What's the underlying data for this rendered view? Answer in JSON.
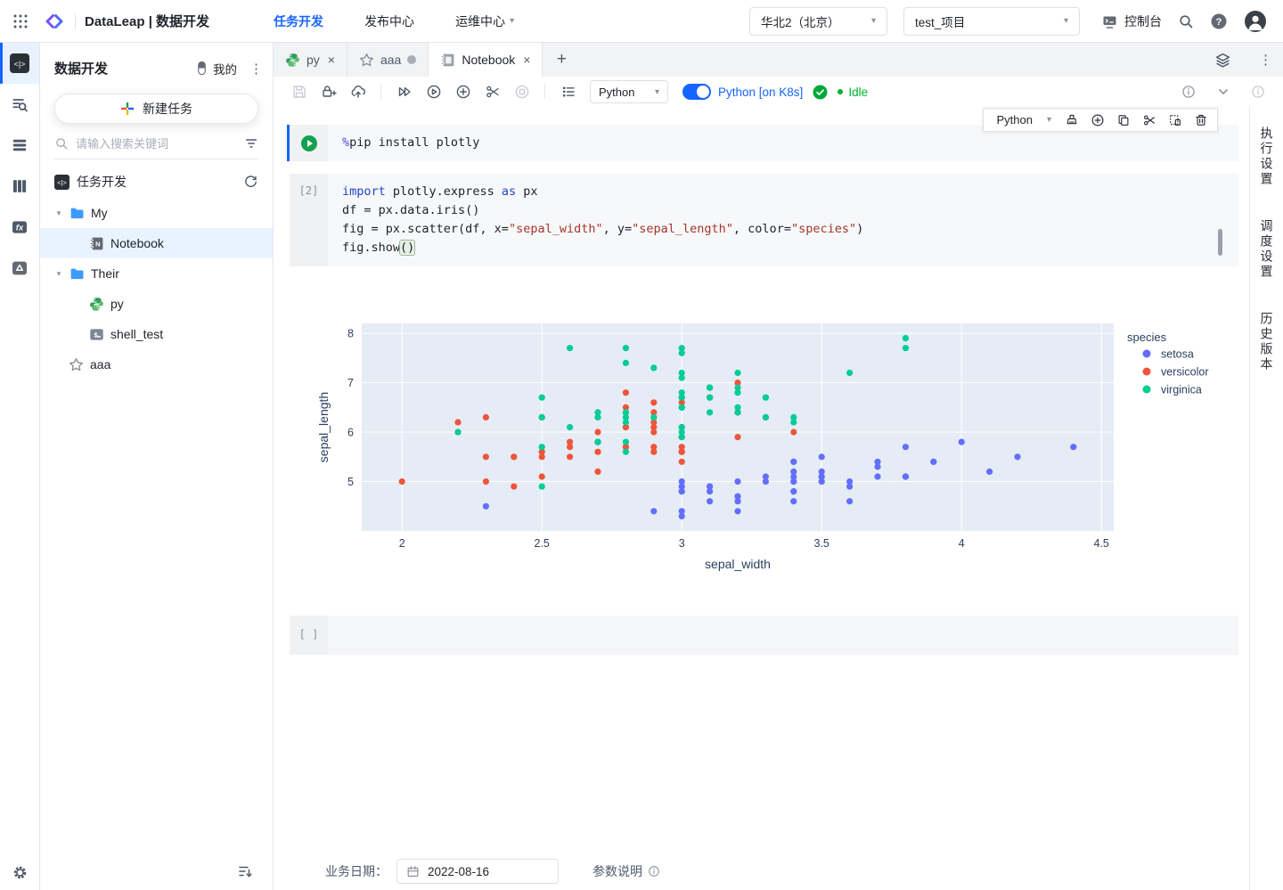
{
  "glyphs": {
    "close": "×",
    "plus": "+",
    "kebab": "⋮",
    "caret": "▾",
    "chev_expanded": "▾"
  },
  "navbar": {
    "brand": "DataLeap | 数据开发",
    "nav": [
      {
        "label": "任务开发",
        "active": true
      },
      {
        "label": "发布中心",
        "active": false
      },
      {
        "label": "运维中心",
        "active": false,
        "dropdown": true
      }
    ],
    "region_select": "华北2（北京）",
    "project_select": "test_项目",
    "console_label": "控制台"
  },
  "rail": {
    "items": [
      {
        "icon": "code",
        "active": true
      },
      {
        "icon": "search-list",
        "active": false
      },
      {
        "icon": "task-list",
        "active": false
      },
      {
        "icon": "data-columns",
        "active": false
      },
      {
        "icon": "function",
        "active": false
      },
      {
        "icon": "resource-drive",
        "active": false
      }
    ]
  },
  "sidebar": {
    "title": "数据开发",
    "mine_label": "我的",
    "new_task_label": "新建任务",
    "search_placeholder": "请输入搜索关键词",
    "section_title": "任务开发",
    "tree": [
      {
        "kind": "folder",
        "label": "My",
        "indent": "a",
        "chevron": true,
        "selected": false
      },
      {
        "kind": "notebook",
        "label": "Notebook",
        "indent": "b",
        "chevron": false,
        "selected": true
      },
      {
        "kind": "folder",
        "label": "Their",
        "indent": "a",
        "chevron": true,
        "selected": false
      },
      {
        "kind": "python",
        "label": "py",
        "indent": "b",
        "chevron": false,
        "selected": false
      },
      {
        "kind": "shell",
        "label": "shell_test",
        "indent": "b",
        "chevron": false,
        "selected": false
      },
      {
        "kind": "star",
        "label": "aaa",
        "indent": "c",
        "chevron": false,
        "selected": false
      }
    ]
  },
  "workspace": {
    "tabs": [
      {
        "label": "py",
        "icon": "python",
        "closable": true,
        "dot": false,
        "active": false
      },
      {
        "label": "aaa",
        "icon": "star",
        "closable": false,
        "dot": true,
        "active": false
      },
      {
        "label": "Notebook",
        "icon": "notebook",
        "closable": true,
        "dot": false,
        "active": true
      }
    ],
    "toolbar": {
      "kernel_select": "Python",
      "k8s_label": "Python [on K8s]",
      "status": "Idle"
    },
    "cell_toolbar": {
      "lang_select": "Python"
    },
    "cells": [
      {
        "index": "",
        "runnable": true,
        "lines": [
          [
            {
              "t": "%",
              "c": "magic"
            },
            {
              "t": "pip install plotly",
              "c": ""
            }
          ]
        ]
      },
      {
        "index": "[2]",
        "runnable": false,
        "lines": [
          [
            {
              "t": "import",
              "c": "kw"
            },
            {
              "t": " plotly.express ",
              "c": ""
            },
            {
              "t": "as",
              "c": "kw"
            },
            {
              "t": " px",
              "c": ""
            }
          ],
          [
            {
              "t": "df = px.data.iris()",
              "c": ""
            }
          ],
          [
            {
              "t": "fig = px.scatter(df, x=",
              "c": ""
            },
            {
              "t": "\"sepal_width\"",
              "c": "str"
            },
            {
              "t": ", y=",
              "c": ""
            },
            {
              "t": "\"sepal_length\"",
              "c": "str"
            },
            {
              "t": ", color=",
              "c": ""
            },
            {
              "t": "\"species\"",
              "c": "str"
            },
            {
              "t": ")",
              "c": ""
            }
          ],
          [
            {
              "t": "fig.show",
              "c": ""
            },
            {
              "t": "()",
              "c": "br"
            }
          ]
        ]
      }
    ],
    "empty_cell_gutter": "[ ]",
    "bottom_bar": {
      "date_label": "业务日期：",
      "date_value": "2022-08-16",
      "params_label": "参数说明"
    }
  },
  "right_panel": {
    "tabs": [
      "执行设置",
      "调度设置",
      "历史版本"
    ]
  },
  "chart_data": {
    "type": "scatter",
    "xlabel": "sepal_width",
    "ylabel": "sepal_length",
    "legend_title": "species",
    "xlim": [
      1.856,
      4.544
    ],
    "ylim": [
      4.0,
      8.2
    ],
    "xticks": [
      2,
      2.5,
      3,
      3.5,
      4,
      4.5
    ],
    "yticks": [
      5,
      6,
      7,
      8
    ],
    "grid": true,
    "legend_position": "right",
    "plot_bg": "#E5ECF6",
    "grid_color": "#FFFFFF",
    "text_color": "#2A3F5F",
    "series": [
      {
        "name": "setosa",
        "color": "#636EFA",
        "x": [
          3.5,
          3.0,
          3.2,
          3.1,
          3.6,
          3.9,
          3.4,
          3.4,
          2.9,
          3.1,
          3.7,
          3.4,
          3.0,
          3.0,
          4.0,
          4.4,
          3.9,
          3.5,
          3.8,
          3.8,
          3.4,
          3.7,
          3.6,
          3.3,
          3.4,
          3.0,
          3.4,
          3.5,
          3.4,
          3.2,
          3.1,
          3.4,
          4.1,
          4.2,
          3.1,
          3.2,
          3.5,
          3.6,
          3.0,
          3.4,
          3.5,
          2.3,
          3.2,
          3.5,
          3.8,
          3.0,
          3.8,
          3.2,
          3.7,
          3.3
        ],
        "y": [
          5.1,
          4.9,
          4.7,
          4.6,
          5.0,
          5.4,
          4.6,
          5.0,
          4.4,
          4.9,
          5.4,
          4.8,
          4.8,
          4.3,
          5.8,
          5.7,
          5.4,
          5.1,
          5.7,
          5.1,
          5.4,
          5.1,
          4.6,
          5.1,
          4.8,
          5.0,
          5.0,
          5.2,
          5.2,
          4.7,
          4.8,
          5.4,
          5.2,
          5.5,
          4.9,
          5.0,
          5.5,
          4.9,
          4.4,
          5.1,
          5.0,
          4.5,
          4.4,
          5.0,
          5.1,
          4.8,
          5.1,
          4.6,
          5.3,
          5.0
        ]
      },
      {
        "name": "versicolor",
        "color": "#EF553B",
        "x": [
          3.2,
          3.2,
          3.1,
          2.3,
          2.8,
          2.8,
          3.3,
          2.4,
          2.9,
          2.7,
          2.0,
          3.0,
          2.2,
          2.9,
          2.9,
          3.1,
          3.0,
          2.7,
          2.2,
          2.5,
          3.2,
          2.8,
          2.5,
          2.8,
          2.9,
          3.0,
          2.8,
          3.0,
          2.9,
          2.6,
          2.4,
          2.4,
          2.7,
          2.7,
          3.0,
          3.4,
          3.1,
          2.3,
          3.0,
          2.5,
          2.6,
          3.0,
          2.6,
          2.3,
          2.7,
          3.0,
          2.9,
          2.9,
          2.5,
          2.8
        ],
        "y": [
          7.0,
          6.4,
          6.9,
          5.5,
          6.5,
          5.7,
          6.3,
          4.9,
          6.6,
          5.2,
          5.0,
          5.9,
          6.0,
          6.1,
          5.6,
          6.7,
          5.6,
          5.8,
          6.2,
          5.6,
          5.9,
          6.1,
          6.3,
          6.1,
          6.4,
          6.6,
          6.8,
          6.7,
          6.0,
          5.7,
          5.5,
          5.5,
          5.8,
          6.0,
          5.4,
          6.0,
          6.7,
          6.3,
          5.6,
          5.5,
          5.5,
          6.1,
          5.8,
          5.0,
          5.6,
          5.7,
          5.7,
          6.2,
          5.1,
          5.7
        ]
      },
      {
        "name": "virginica",
        "color": "#00CC96",
        "x": [
          3.3,
          2.7,
          3.0,
          2.9,
          3.0,
          3.0,
          2.5,
          2.9,
          2.5,
          3.6,
          3.2,
          2.7,
          3.0,
          2.5,
          2.8,
          3.2,
          3.0,
          3.8,
          2.6,
          2.2,
          3.2,
          2.8,
          2.8,
          2.7,
          3.3,
          3.2,
          2.8,
          3.0,
          2.8,
          3.0,
          2.8,
          3.8,
          2.8,
          2.8,
          2.6,
          3.0,
          3.4,
          3.1,
          3.0,
          3.1,
          3.1,
          3.1,
          2.7,
          3.2,
          3.3,
          3.0,
          2.5,
          3.0,
          3.4,
          3.0
        ],
        "y": [
          6.3,
          5.8,
          7.1,
          6.3,
          6.5,
          7.6,
          4.9,
          7.3,
          6.7,
          7.2,
          6.5,
          6.4,
          6.8,
          5.7,
          5.8,
          6.4,
          6.5,
          7.7,
          7.7,
          6.0,
          6.9,
          5.6,
          7.7,
          6.3,
          6.7,
          7.2,
          6.2,
          6.1,
          6.4,
          7.2,
          7.4,
          7.9,
          6.4,
          6.3,
          6.1,
          7.7,
          6.3,
          6.4,
          6.0,
          6.9,
          6.7,
          6.9,
          5.8,
          6.8,
          6.7,
          6.7,
          6.3,
          6.5,
          6.2,
          5.9
        ]
      }
    ]
  }
}
